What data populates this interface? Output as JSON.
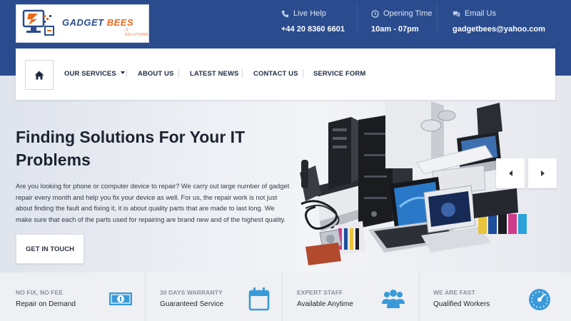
{
  "brand": {
    "name_part1": "GADGET",
    "name_part2": "BEES",
    "tagline": "IT SOLUTIONS",
    "colors": {
      "primary": "#2a4c8e",
      "accent": "#ea6a1c",
      "icon_blue": "#3a9ad9"
    }
  },
  "contact": {
    "live_help": {
      "label": "Live Help",
      "value": "+44 20 8360 6601",
      "icon": "phone-icon"
    },
    "opening_time": {
      "label": "Opening Time",
      "value": "10am - 07pm",
      "icon": "clock-icon"
    },
    "email": {
      "label": "Email Us",
      "value": "gadgetbees@yahoo.com",
      "icon": "chat-icon"
    }
  },
  "nav": {
    "home_icon": "home-icon",
    "items": [
      {
        "label": "OUR SERVICES",
        "has_dropdown": true
      },
      {
        "label": "ABOUT US"
      },
      {
        "label": "LATEST NEWS"
      },
      {
        "label": "CONTACT US"
      },
      {
        "label": "SERVICE FORM"
      }
    ]
  },
  "hero": {
    "title": "Finding Solutions For Your IT Problems",
    "text": "Are you looking for phone or computer device to repair? We carry out large number of gadget repair every month and help you fix your device as well. For us, the repair work is not just about finding the fault and fixing it, it is about quality parts that are made to last long. We make sure that each of the parts used for repairing are brand new and of the highest quality.",
    "cta_label": "GET IN TOUCH",
    "prev_icon": "chevron-left-icon",
    "next_icon": "chevron-right-icon"
  },
  "features": [
    {
      "title": "NO FIX, NO FEE",
      "subtitle": "Repair on Demand",
      "icon": "money-icon"
    },
    {
      "title": "30 DAYS WARRANTY",
      "subtitle": "Guaranteed Service",
      "icon": "calendar-icon"
    },
    {
      "title": "EXPERT STAFF",
      "subtitle": "Available Anytime",
      "icon": "team-icon"
    },
    {
      "title": "WE ARE FAST",
      "subtitle": "Qualified Workers",
      "icon": "speedometer-icon"
    }
  ]
}
